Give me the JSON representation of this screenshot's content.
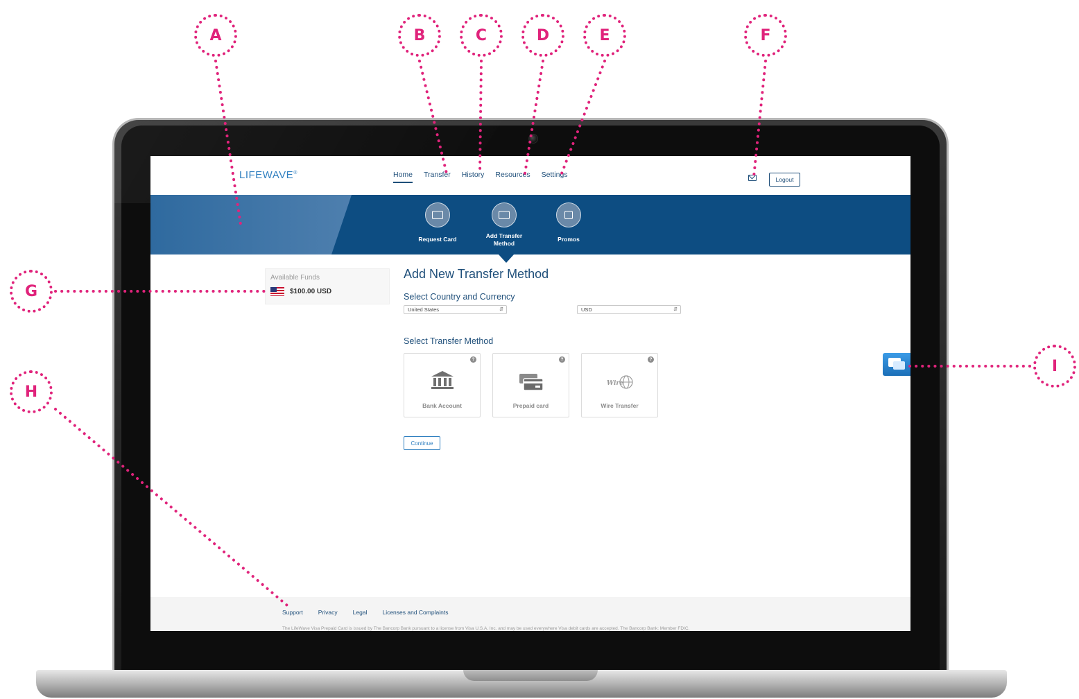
{
  "brand": {
    "logo_text": "LIFEWAVE",
    "logo_mark": "®"
  },
  "nav": {
    "items": [
      {
        "label": "Home",
        "active": true
      },
      {
        "label": "Transfer",
        "active": false
      },
      {
        "label": "History",
        "active": false
      },
      {
        "label": "Resources",
        "active": false
      },
      {
        "label": "Settings",
        "active": false
      }
    ],
    "mail_icon": "envelope-icon",
    "logout_label": "Logout"
  },
  "banner": {
    "tiles": [
      {
        "label": "Request Card",
        "icon": "card-request-icon"
      },
      {
        "label": "Add Transfer\nMethod",
        "icon": "transfer-method-icon"
      },
      {
        "label": "Promos",
        "icon": "gift-icon"
      }
    ]
  },
  "funds": {
    "label": "Available Funds",
    "amount": "$100.00 USD",
    "flag_icon": "us-flag-icon"
  },
  "main": {
    "title": "Add New Transfer Method",
    "country_section": "Select Country and Currency",
    "country_value": "United States",
    "currency_value": "USD",
    "method_section": "Select Transfer Method",
    "methods": [
      {
        "label": "Bank Account",
        "icon": "bank-icon"
      },
      {
        "label": "Prepaid card",
        "icon": "prepaid-card-icon"
      },
      {
        "label": "Wire Transfer",
        "icon": "wire-globe-icon"
      }
    ],
    "help_glyph": "?",
    "continue_label": "Continue"
  },
  "footer": {
    "links": [
      "Support",
      "Privacy",
      "Legal",
      "Licenses and Complaints"
    ],
    "disclaimer": "The LifeWave Visa Prepaid Card is issued by The Bancorp Bank pursuant to a license from Visa U.S.A. Inc. and may be used everywhere Visa debit cards are accepted. The Bancorp Bank; Member FDIC."
  },
  "chat_icon": "chat-bubbles-icon",
  "callouts": {
    "a": "A",
    "b": "B",
    "c": "C",
    "d": "D",
    "e": "E",
    "f": "F",
    "g": "G",
    "h": "H",
    "i": "I"
  },
  "colors": {
    "callout": "#e0237b",
    "brand_blue": "#0d4d82",
    "link_blue": "#1f4f7a"
  }
}
